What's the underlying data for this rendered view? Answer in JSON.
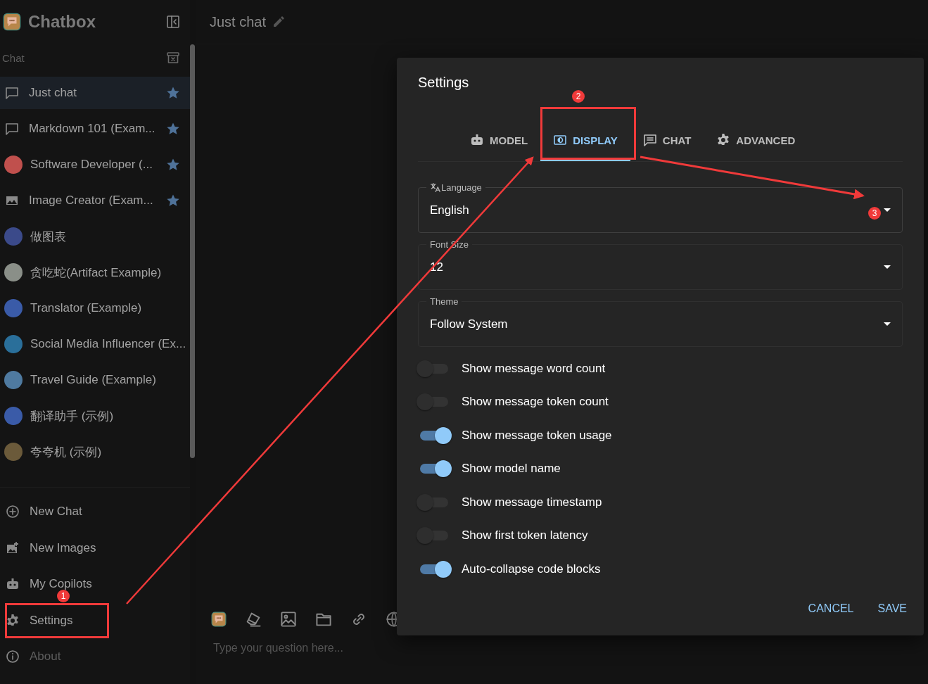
{
  "app": {
    "name": "Chatbox"
  },
  "sidebar": {
    "section_label": "Chat",
    "sessions": [
      {
        "title": "Just chat",
        "kind": "chat",
        "selected": true,
        "starred": true
      },
      {
        "title": "Markdown 101 (Exam...",
        "kind": "chat",
        "selected": false,
        "starred": true
      },
      {
        "title": "Software Developer (...",
        "kind": "avatar",
        "color": "#c0504d",
        "selected": false,
        "starred": true
      },
      {
        "title": "Image Creator (Exam...",
        "kind": "image",
        "selected": false,
        "starred": true
      },
      {
        "title": "做图表",
        "kind": "avatar",
        "color": "#3b4a8a",
        "selected": false,
        "starred": false
      },
      {
        "title": "贪吃蛇(Artifact Example)",
        "kind": "avatar",
        "color": "#8a8f88",
        "selected": false,
        "starred": false
      },
      {
        "title": "Translator (Example)",
        "kind": "avatar",
        "color": "#3a5ba8",
        "selected": false,
        "starred": false
      },
      {
        "title": "Social Media Influencer (Ex...",
        "kind": "avatar",
        "color": "#2a6f9a",
        "selected": false,
        "starred": false
      },
      {
        "title": "Travel Guide (Example)",
        "kind": "avatar",
        "color": "#4f7aa0",
        "selected": false,
        "starred": false
      },
      {
        "title": "翻译助手 (示例)",
        "kind": "avatar",
        "color": "#3a5ba8",
        "selected": false,
        "starred": false
      },
      {
        "title": "夸夸机 (示例)",
        "kind": "avatar",
        "color": "#6b5a3a",
        "selected": false,
        "starred": false
      }
    ],
    "menu": [
      {
        "label": "New Chat",
        "kind": "new-chat"
      },
      {
        "label": "New Images",
        "kind": "new-images"
      },
      {
        "label": "My Copilots",
        "kind": "copilots"
      },
      {
        "label": "Settings",
        "kind": "settings"
      },
      {
        "label": "About",
        "kind": "about"
      }
    ]
  },
  "main": {
    "title": "Just chat",
    "input": {
      "placeholder": "Type your question here..."
    }
  },
  "settings": {
    "title": "Settings",
    "tabs": [
      {
        "label": "MODEL",
        "kind": "model",
        "selected": false
      },
      {
        "label": "DISPLAY",
        "kind": "display",
        "selected": true
      },
      {
        "label": "CHAT",
        "kind": "chat",
        "selected": false
      },
      {
        "label": "ADVANCED",
        "kind": "advanced",
        "selected": false
      }
    ],
    "fields": [
      {
        "label": "Language",
        "kind": "language",
        "value": "English"
      },
      {
        "label": "Font Size",
        "kind": "plain",
        "value": "12"
      },
      {
        "label": "Theme",
        "kind": "plain",
        "value": "Follow System"
      }
    ],
    "toggles": [
      {
        "label": "Show message word count",
        "on": false
      },
      {
        "label": "Show message token count",
        "on": false
      },
      {
        "label": "Show message token usage",
        "on": true
      },
      {
        "label": "Show model name",
        "on": true
      },
      {
        "label": "Show message timestamp",
        "on": false
      },
      {
        "label": "Show first token latency",
        "on": false
      },
      {
        "label": "Auto-collapse code blocks",
        "on": true
      }
    ],
    "buttons": [
      "CANCEL",
      "SAVE"
    ]
  },
  "annotations": {
    "badges": [
      "1",
      "2",
      "3"
    ]
  }
}
